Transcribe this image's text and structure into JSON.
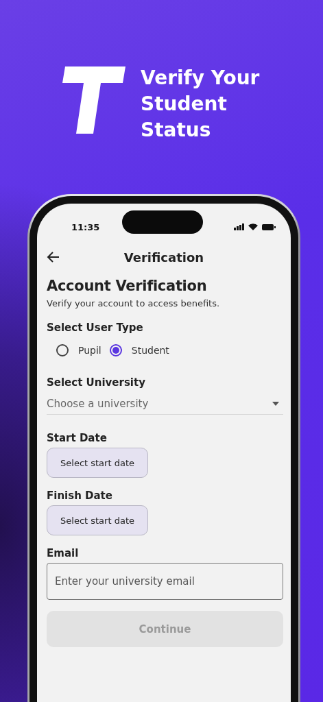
{
  "header": {
    "title": "Verify Your Student Status"
  },
  "status_bar": {
    "time": "11:35"
  },
  "nav": {
    "title": "Verification"
  },
  "form": {
    "heading": "Account Verification",
    "subtitle": "Verify your account to access benefits.",
    "user_type": {
      "label": "Select User Type",
      "options": [
        {
          "label": "Pupil",
          "selected": false
        },
        {
          "label": "Student",
          "selected": true
        }
      ]
    },
    "university": {
      "label": "Select University",
      "placeholder": "Choose a university"
    },
    "start_date": {
      "label": "Start Date",
      "button": "Select start date"
    },
    "finish_date": {
      "label": "Finish Date",
      "button": "Select start date"
    },
    "email": {
      "label": "Email",
      "placeholder": "Enter your university email"
    },
    "continue_button": {
      "label": "Continue",
      "disabled": true
    }
  }
}
